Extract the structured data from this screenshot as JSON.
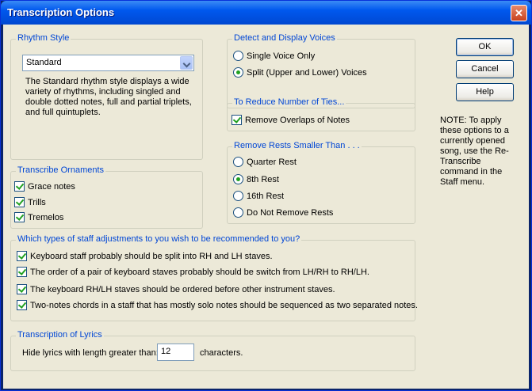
{
  "window": {
    "title": "Transcription Options",
    "close_glyph": "✕"
  },
  "buttons": {
    "ok": "OK",
    "cancel": "Cancel",
    "help": "Help"
  },
  "note": "NOTE: To apply these options to a currently opened song, use the Re-Transcribe command in the Staff menu.",
  "rhythm_style": {
    "title": "Rhythm Style",
    "selected": "Standard",
    "description": "The Standard rhythm style displays a wide variety of rhythms, including singled and double dotted notes, full and partial triplets, and full quintuplets."
  },
  "ornaments": {
    "title": "Transcribe Ornaments",
    "items": [
      {
        "label": "Grace notes",
        "checked": true
      },
      {
        "label": "Trills",
        "checked": true
      },
      {
        "label": "Tremelos",
        "checked": true
      }
    ]
  },
  "voices": {
    "title": "Detect and Display Voices",
    "options": [
      {
        "label": "Single Voice Only",
        "selected": false
      },
      {
        "label": "Split (Upper and Lower) Voices",
        "selected": true
      }
    ]
  },
  "ties": {
    "title": "To Reduce Number of Ties...",
    "items": [
      {
        "label": "Remove Overlaps of Notes",
        "checked": true
      }
    ]
  },
  "rests": {
    "title": "Remove Rests Smaller Than . . .",
    "options": [
      {
        "label": "Quarter Rest",
        "selected": false
      },
      {
        "label": "8th Rest",
        "selected": true
      },
      {
        "label": "16th Rest",
        "selected": false
      },
      {
        "label": "Do Not Remove Rests",
        "selected": false
      }
    ]
  },
  "staff": {
    "title": "Which types of staff adjustments to you wish to be recommended to you?",
    "items": [
      {
        "label": "Keyboard staff probably should be split into RH and LH staves.",
        "checked": true
      },
      {
        "label": "The order of a pair of keyboard staves probably should be switch from LH/RH to RH/LH.",
        "checked": true
      },
      {
        "label": "The keyboard RH/LH staves should be ordered before other instrument staves.",
        "checked": true
      },
      {
        "label": "Two-notes chords in a staff that has mostly solo notes should be sequenced as two separated notes.",
        "checked": true
      }
    ]
  },
  "lyrics": {
    "title": "Transcription of Lyrics",
    "label": "Hide lyrics with length greater than:",
    "value": "12",
    "suffix": "characters."
  }
}
